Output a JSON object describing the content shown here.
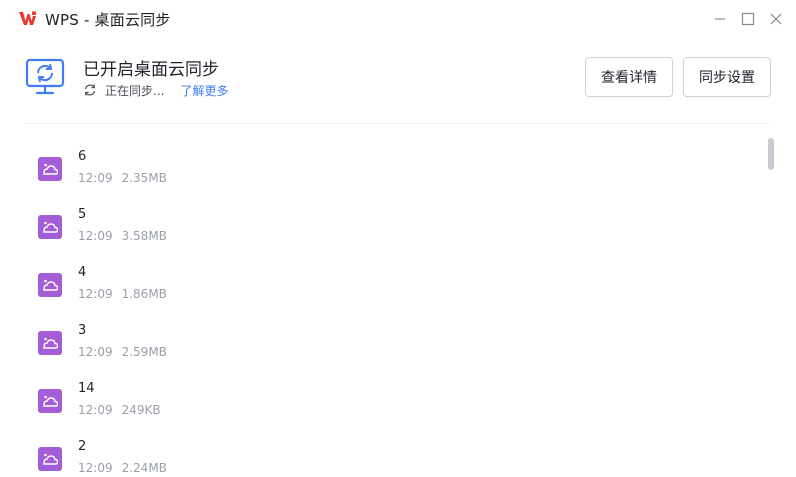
{
  "window": {
    "title": "WPS - 桌面云同步",
    "logo_text": "W"
  },
  "header": {
    "title": "已开启桌面云同步",
    "status": "正在同步...",
    "learn_more": "了解更多",
    "details_button": "查看详情",
    "settings_button": "同步设置"
  },
  "files": [
    {
      "name": "6",
      "time": "12:09",
      "size": "2.35MB"
    },
    {
      "name": "5",
      "time": "12:09",
      "size": "3.58MB"
    },
    {
      "name": "4",
      "time": "12:09",
      "size": "1.86MB"
    },
    {
      "name": "3",
      "time": "12:09",
      "size": "2.59MB"
    },
    {
      "name": "14",
      "time": "12:09",
      "size": "249KB"
    },
    {
      "name": "2",
      "time": "12:09",
      "size": "2.24MB"
    }
  ],
  "colors": {
    "accent": "#3f7cf6",
    "file_icon": "#a35dd6",
    "logo_red": "#e8382f"
  },
  "icons": {
    "app_logo": "wps-logo-icon",
    "monitor": "monitor-sync-icon",
    "status": "refresh-icon",
    "file": "cloud-image-icon"
  }
}
